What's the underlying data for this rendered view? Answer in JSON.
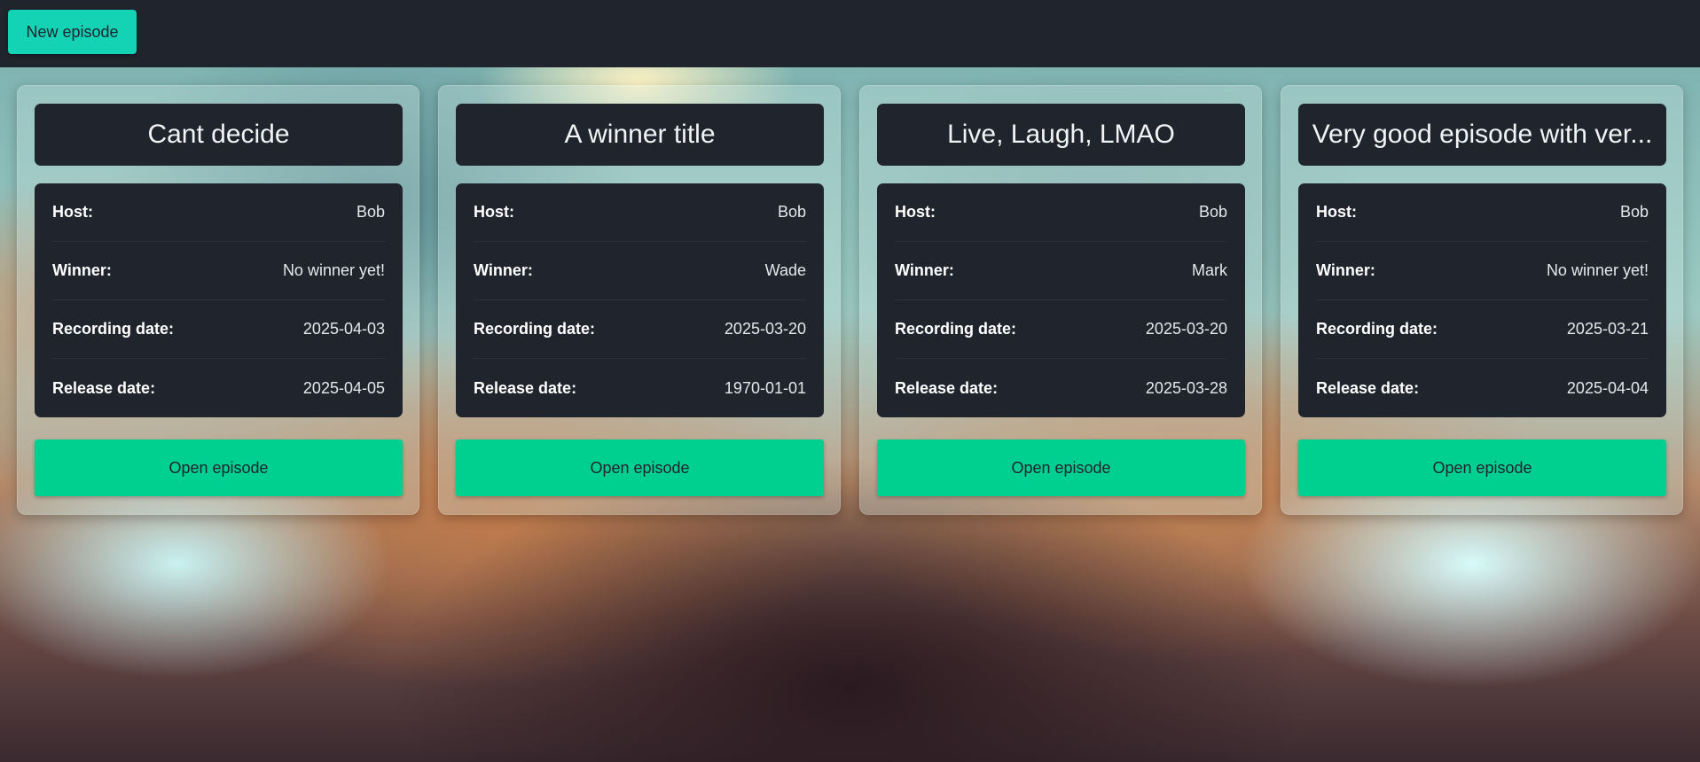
{
  "toolbar": {
    "new_episode_label": "New episode"
  },
  "labels": {
    "host": "Host:",
    "winner": "Winner:",
    "recording_date": "Recording date:",
    "release_date": "Release date:",
    "open_episode": "Open episode"
  },
  "episodes": [
    {
      "title": "Cant decide",
      "host": "Bob",
      "winner": "No winner yet!",
      "recording_date": "2025-04-03",
      "release_date": "2025-04-05"
    },
    {
      "title": "A winner title",
      "host": "Bob",
      "winner": "Wade",
      "recording_date": "2025-03-20",
      "release_date": "1970-01-01"
    },
    {
      "title": "Live, Laugh, LMAO",
      "host": "Bob",
      "winner": "Mark",
      "recording_date": "2025-03-20",
      "release_date": "2025-03-28"
    },
    {
      "title": "Very good episode with ver...",
      "host": "Bob",
      "winner": "No winner yet!",
      "recording_date": "2025-03-21",
      "release_date": "2025-04-04"
    }
  ],
  "colors": {
    "topbar": "#1f242d",
    "new_button": "#14d2b4",
    "open_button": "#00d08f",
    "panel": "#1f242d"
  }
}
